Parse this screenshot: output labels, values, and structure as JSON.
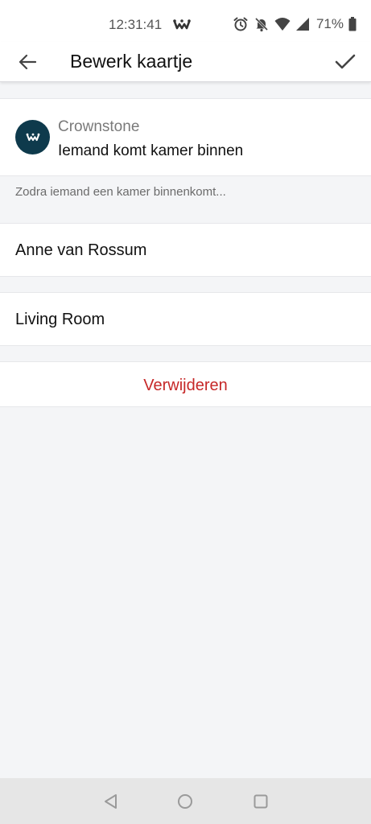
{
  "status_bar": {
    "time": "12:31:41",
    "battery": "71%",
    "icons": [
      "crownstone-app-icon",
      "alarm-icon",
      "notifications-off-icon",
      "wifi-icon",
      "signal-icon",
      "battery-icon"
    ]
  },
  "app_bar": {
    "title": "Bewerk kaartje",
    "back_icon": "arrow-back-icon",
    "confirm_icon": "check-icon"
  },
  "trigger": {
    "provider": "Crownstone",
    "text": "Iemand komt kamer binnen",
    "avatar_color": "#0e3a4c"
  },
  "hint": "Zodra iemand een kamer binnenkomt...",
  "person": "Anne van Rossum",
  "room": "Living Room",
  "delete_label": "Verwijderen",
  "colors": {
    "delete": "#c62828",
    "background": "#f4f5f7"
  }
}
